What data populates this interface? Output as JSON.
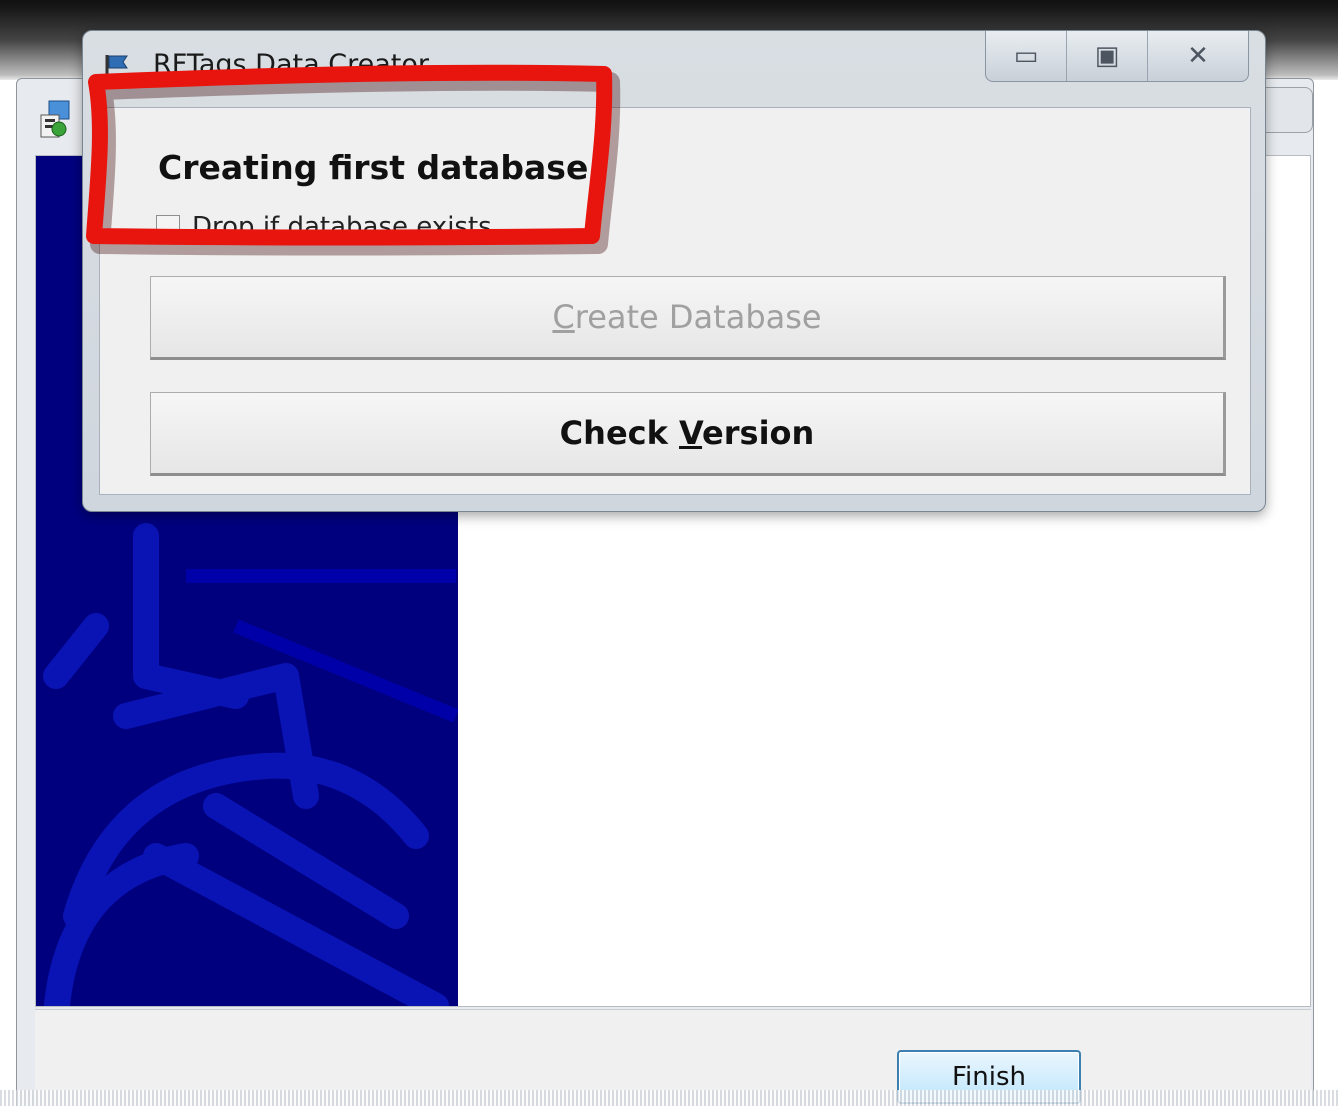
{
  "back_window": {
    "finish_label": "Finish"
  },
  "dialog": {
    "title": "RFTags Data Creator",
    "heading": "Creating first database",
    "drop_checkbox_label": "Drop if database exists",
    "drop_checked": false,
    "create_database": {
      "mnemonic": "C",
      "rest": "reate Database",
      "enabled": false
    },
    "check_version": {
      "prefix": "Check ",
      "mnemonic": "V",
      "rest": "ersion"
    },
    "caption": {
      "minimize": "▭",
      "maximize": "▣",
      "close": "✕"
    }
  },
  "icons": {
    "app_icon": "setup-app-icon",
    "dialog_icon": "flag-icon",
    "minimize": "minimize-icon",
    "maximize": "maximize-icon",
    "close": "close-icon"
  },
  "colors": {
    "banner": "#00007f",
    "banner_art": "#0a14b4",
    "annotation": "#e8150f",
    "finish_border": "#3c7fb1"
  }
}
